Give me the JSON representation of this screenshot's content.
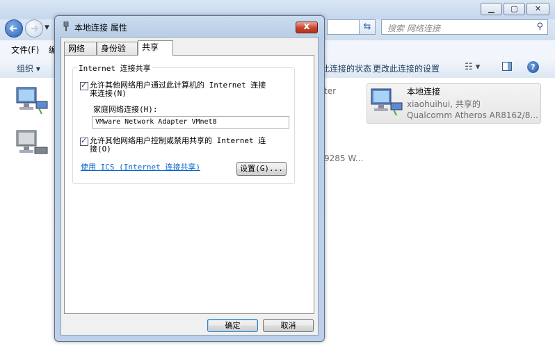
{
  "explorer": {
    "search_placeholder": "搜索 网络连接",
    "menu": {
      "file": "文件(F)",
      "edit": "编"
    },
    "commands": {
      "organize": "组织 ▾",
      "status": "看此连接的状态",
      "change_settings": "更改此连接的设置"
    },
    "partial": {
      "adapter_fragment": "ter",
      "speed_fragment": "9285 W..."
    },
    "selected_connection": {
      "name": "本地连接",
      "status": "xiaohuihui, 共享的",
      "adapter": "Qualcomm Atheros AR8162/8..."
    }
  },
  "dialog": {
    "title": "本地连接 属性",
    "tabs": [
      {
        "label": "网络"
      },
      {
        "label": "身份验证"
      },
      {
        "label": "共享"
      }
    ],
    "group_title": "Internet 连接共享",
    "allow_connect": {
      "line1": "允许其他网络用户通过此计算机的 Internet 连接",
      "line2": "来连接(N)",
      "checked": true
    },
    "home_network_label": "家庭网络连接(H):",
    "home_network_value": "VMware Network Adapter VMnet8",
    "allow_control": {
      "line1": "允许其他网络用户控制或禁用共享的 Internet 连",
      "line2": "接(O)",
      "checked": true
    },
    "ics_link": "使用 ICS (Internet 连接共享)",
    "settings_button": "设置(G)...",
    "ok_button": "确定",
    "cancel_button": "取消"
  }
}
